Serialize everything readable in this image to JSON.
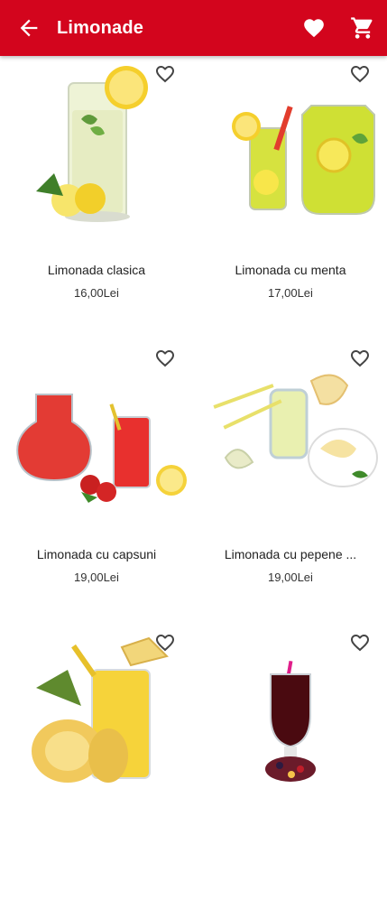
{
  "appbar": {
    "title": "Limonade",
    "back_icon": "arrow-left-icon",
    "favorites_icon": "heart-icon",
    "cart_icon": "shopping-cart-icon",
    "background": "#d3051d"
  },
  "products": [
    {
      "name": "Limonada clasica",
      "price": "16,00Lei",
      "image": "classic-lemonade-glass"
    },
    {
      "name": "Limonada cu menta",
      "price": "17,00Lei",
      "image": "mint-lemonade-jug"
    },
    {
      "name": "Limonada cu capsuni",
      "price": "19,00Lei",
      "image": "strawberry-lemonade"
    },
    {
      "name": "Limonada cu pepene ...",
      "price": "19,00Lei",
      "image": "melon-lemonade"
    },
    {
      "name": "",
      "price": "",
      "image": "pineapple-lemonade"
    },
    {
      "name": "",
      "price": "",
      "image": "red-berry-lemonade"
    }
  ]
}
